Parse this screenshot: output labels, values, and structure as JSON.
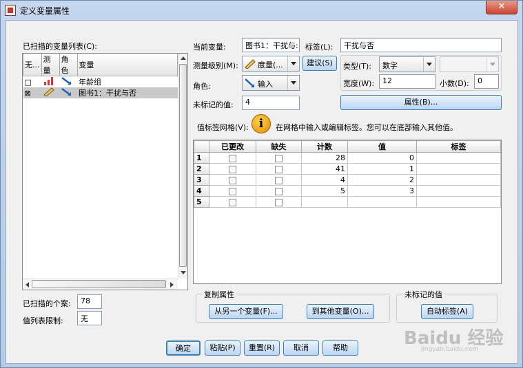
{
  "window": {
    "title": "定义变量属性",
    "close": "✕"
  },
  "left": {
    "list_label": "已扫描的变量列表(C):",
    "columns": [
      "无...",
      "测量",
      "角色",
      "变量"
    ],
    "rows": [
      {
        "name": "年龄组",
        "checked": "□"
      },
      {
        "name": "图书1：干扰与否",
        "checked": "⊠"
      }
    ],
    "cases_label": "已扫描的个案:",
    "cases_value": "78",
    "limit_label": "值列表限制:",
    "limit_value": "无"
  },
  "props": {
    "current_var_label": "当前变量:",
    "current_var_value": "图书1：干扰与:",
    "label_label": "标签(L):",
    "label_value": "干扰与否",
    "measure_label": "测量级别(M):",
    "measure_value": "度量(...",
    "suggest_button": "建议(S)",
    "type_label": "类型(T):",
    "type_value": "数字",
    "role_label": "角色:",
    "role_value": "输入",
    "width_label": "宽度(W):",
    "width_value": "12",
    "decimals_label": "小数(D):",
    "decimals_value": "0",
    "unlabeled_label": "未标记的值:",
    "unlabeled_value": "4",
    "attributes_button": "属性(B)...",
    "grid_label": "值标签网格(V):",
    "grid_hint": "在网格中输入或编辑标签。您可以在底部输入其他值。"
  },
  "grid": {
    "headers": [
      "已更改",
      "缺失",
      "计数",
      "值",
      "标签"
    ],
    "rows": [
      {
        "n": "1",
        "count": "28",
        "value": "0",
        "label": ""
      },
      {
        "n": "2",
        "count": "41",
        "value": "1",
        "label": ""
      },
      {
        "n": "3",
        "count": "4",
        "value": "2",
        "label": ""
      },
      {
        "n": "4",
        "count": "5",
        "value": "3",
        "label": ""
      },
      {
        "n": "5",
        "count": "",
        "value": "",
        "label": ""
      }
    ]
  },
  "copy": {
    "group_title": "复制属性",
    "from_button": "从另一个变量(F)...",
    "to_button": "到其他变量(O)...",
    "unlabeled_group_title": "未标记的值",
    "auto_label_button": "自动标签(A)"
  },
  "footer": {
    "ok": "确定",
    "paste": "粘贴(P)",
    "reset": "重置(R)",
    "cancel": "取消",
    "help": "帮助"
  },
  "watermark": {
    "main": "Baidu 经验",
    "sub": "jingyan.baidu.com"
  }
}
